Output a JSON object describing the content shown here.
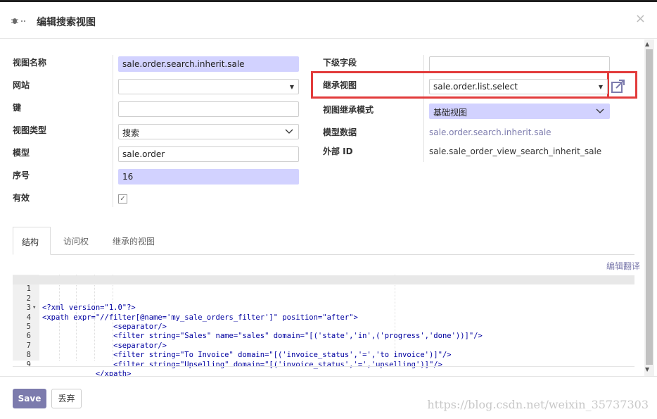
{
  "header": {
    "icon": "bug-icon",
    "title": "编辑搜索视图",
    "close_glyph": "×"
  },
  "form": {
    "view_name_label": "视图名称",
    "view_name_value": "sale.order.search.inherit.sale",
    "website_label": "网站",
    "website_value": "",
    "key_label": "键",
    "key_value": "",
    "view_type_label": "视图类型",
    "view_type_value": "搜索",
    "model_label": "模型",
    "model_value": "sale.order",
    "sequence_label": "序号",
    "sequence_value": "16",
    "active_label": "有效",
    "active_checked": true,
    "child_field_label": "下级字段",
    "child_field_value": "",
    "inherit_view_label": "继承视图",
    "inherit_view_value": "sale.order.list.select",
    "inherit_mode_label": "视图继承模式",
    "inherit_mode_value": "基础视图",
    "model_data_label": "模型数据",
    "model_data_value": "sale.order.search.inherit.sale",
    "external_id_label": "外部 ID",
    "external_id_value": "sale.sale_order_view_search_inherit_sale"
  },
  "tabs": [
    {
      "label": "结构",
      "active": true
    },
    {
      "label": "访问权",
      "active": false
    },
    {
      "label": "继承的视图",
      "active": false
    }
  ],
  "edit_translate": "编辑翻译",
  "code": [
    {
      "n": "1",
      "fold": "",
      "text": "<?xml version=\"1.0\"?>"
    },
    {
      "n": "2",
      "fold": "▾",
      "text": "<xpath expr=\"//filter[@name='my_sale_orders_filter']\" position=\"after\">"
    },
    {
      "n": "3",
      "fold": "",
      "text": "                <separator/>"
    },
    {
      "n": "4",
      "fold": "",
      "text": "                <filter string=\"Sales\" name=\"sales\" domain=\"[('state','in',('progress','done'))]\"/>"
    },
    {
      "n": "5",
      "fold": "",
      "text": "                <separator/>"
    },
    {
      "n": "6",
      "fold": "",
      "text": "                <filter string=\"To Invoice\" domain=\"[('invoice_status','=','to invoice')]\"/>"
    },
    {
      "n": "7",
      "fold": "",
      "text": "                <filter string=\"Upselling\" domain=\"[('invoice_status','=','upselling')]\"/>"
    },
    {
      "n": "8",
      "fold": "",
      "text": "            </xpath>"
    },
    {
      "n": "9",
      "fold": "",
      "text": ""
    }
  ],
  "footer": {
    "save_label": "Save",
    "discard_label": "丢弃",
    "watermark": "https://blog.csdn.net/weixin_35737303"
  },
  "colors": {
    "primary": "#7c7bad",
    "required_field": "#d2d2ff",
    "highlight": "#e23b3b"
  }
}
